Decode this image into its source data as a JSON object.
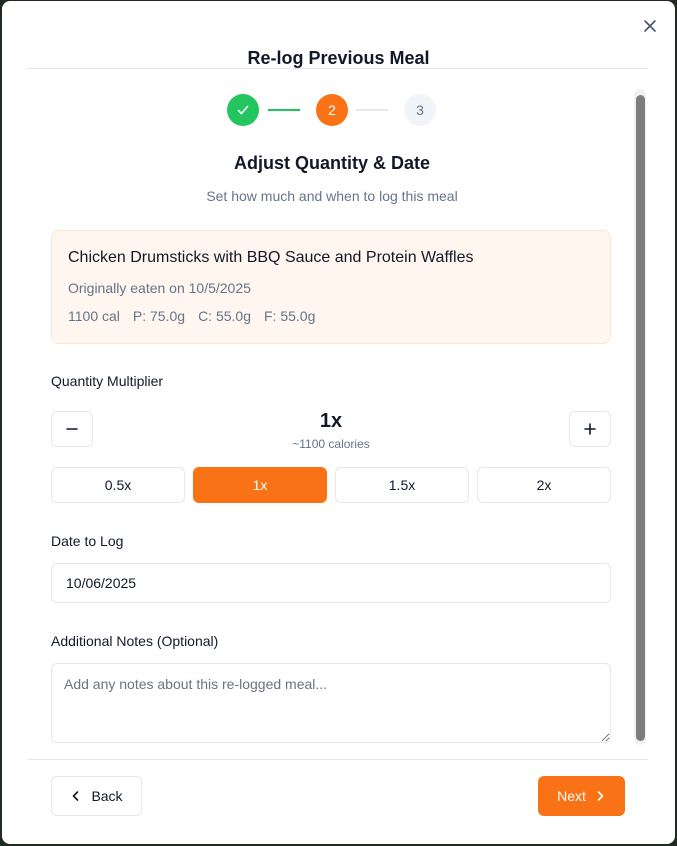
{
  "dialog": {
    "title": "Re-log Previous Meal",
    "close_label": "×"
  },
  "stepper": {
    "steps": [
      {
        "label": "✓",
        "state": "complete"
      },
      {
        "label": "2",
        "state": "current"
      },
      {
        "label": "3",
        "state": "upcoming"
      }
    ]
  },
  "step": {
    "heading": "Adjust Quantity & Date",
    "subheading": "Set how much and when to log this meal"
  },
  "meal": {
    "name": "Chicken Drumsticks with BBQ Sauce and Protein Waffles",
    "original_date": "Originally eaten on 10/5/2025",
    "calories": "1100 cal",
    "protein": "P: 75.0g",
    "carbs": "C: 55.0g",
    "fat": "F: 55.0g"
  },
  "quantity": {
    "label": "Quantity Multiplier",
    "value": "1x",
    "calories": "~1100 calories",
    "presets": [
      "0.5x",
      "1x",
      "1.5x",
      "2x"
    ],
    "selected": "1x"
  },
  "date": {
    "label": "Date to Log",
    "value": "10/06/2025"
  },
  "notes": {
    "label": "Additional Notes (Optional)",
    "placeholder": "Add any notes about this re-logged meal...",
    "value": ""
  },
  "footer": {
    "back_label": "Back",
    "next_label": "Next"
  },
  "colors": {
    "accent": "#f97316",
    "success": "#22c55e"
  }
}
